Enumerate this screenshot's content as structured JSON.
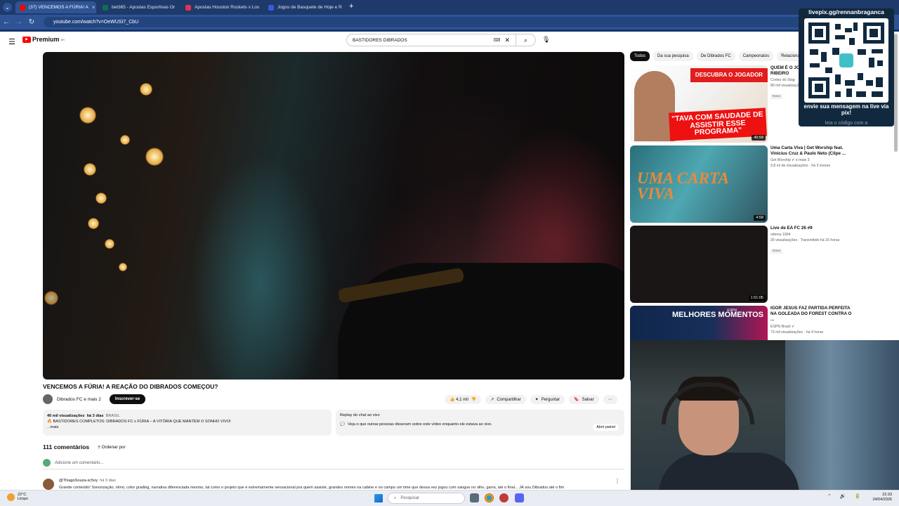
{
  "browser": {
    "tabs": [
      {
        "label": "(37) VENCEMOS A FÚRIA! A",
        "active": true,
        "color": "#ff0000"
      },
      {
        "label": "bet365 - Apostas Esportivas Or",
        "active": false,
        "color": "#126e51"
      },
      {
        "label": "Apostas Houston Rockets x Los",
        "active": false,
        "color": "#e0344a"
      },
      {
        "label": "Jogos de Basquete de Hoje e R",
        "active": false,
        "color": "#3a5bd9"
      }
    ],
    "url": "youtube.com/watch?v=OeWUSI7_CbU"
  },
  "youtube": {
    "logo": "Premium",
    "logo_badge": "BR",
    "search_value": "BASTIDORES DIBRADOS"
  },
  "video": {
    "title": "VENCEMOS A FÚRIA! A REAÇÃO DO DIBRADOS COMEÇOU?",
    "channel": "Dibrados FC e mais 2",
    "subscribe": "Inscrever-se",
    "likes": "4,1 mil",
    "share": "Compartilhar",
    "ask": "Perguntar",
    "save": "Salvar"
  },
  "description": {
    "views": "40 mil visualizações",
    "age": "há 3 dias",
    "country": "BRASIL",
    "text": "🔥 BASTIDORES COMPLETOS: DIBRADOS FC x FÚRIA – A VITÓRIA QUE MANTÉM O SONHO VIVO!",
    "more": "...mais"
  },
  "replay": {
    "title": "Replay do chat ao vivo",
    "text": "Veja o que outras pessoas disseram sobre este vídeo enquanto ele estava ao vivo.",
    "button": "Abrir painel"
  },
  "comments": {
    "count": "111 comentários",
    "sort": "Ordenar por",
    "add_placeholder": "Adicione um comentário...",
    "first": {
      "author": "@ThiagoSouza-sc5oy",
      "time": "há 3 dias",
      "text": "Grande conteúdo! Sonorização, ritmo, color grading, narrativa diferenciada mesmo, tal como o projeto que é extremamente sensacional pra quem assiste, grandes nomes na cabine e no campo um time que dessa vez jogou com sangue no olho, garra, até o final... JÁ sou Dibrados até o fim"
    }
  },
  "chips": [
    "Todos",
    "Da sua pesquisa",
    "De Dibrados FC",
    "Campeonatos",
    "Relacionados"
  ],
  "recommendations": [
    {
      "title": "QUEM É O JOGADOR? FT. CAIO RIBEIRO",
      "channel": "Cortes do Stag",
      "views": "80 mil visualizações",
      "badge": "Novo",
      "duration": "49:58",
      "thumb_banner": "DESCUBRA O JOGADOR",
      "thumb_caption": "\"TAVA COM SAUDADE DE ASSISTIR ESSE PROGRAMA\""
    },
    {
      "title": "Uma Carta Viva | Get Worship feat. Vinicius Cruz & Paulo Neto (Clipe ...",
      "channel": "Get Worship ✔ e mais 3",
      "views": "9,8 mi de visualizações · há 3 meses",
      "badge": "",
      "duration": "4:58",
      "thumb_caption": "UMA CARTA VIVA"
    },
    {
      "title": "Live de EA FC 26 #9",
      "channel": "vdemu 1904",
      "views": "26 visualizações · Transmitido há 16 horas",
      "badge": "Novo",
      "duration": "1:51:05"
    },
    {
      "title": "IGOR JESUS FAZ PARTIDA PERFEITA NA GOLEADA DO FOREST CONTRA O ...",
      "channel": "ESPN Brasil ✔",
      "views": "73 mil visualizações · há 4 horas",
      "badge": "Novo",
      "duration": "",
      "thumb_caption": "MELHORES MOMENTOS",
      "thumb_brand": "ESPN"
    }
  ],
  "overlay": {
    "handle": "livepix.gg/rennanbraganca",
    "caption": "envie sua mensagem na live via pix!",
    "caption2": "leia o código com a"
  },
  "taskbar": {
    "temp": "22°C",
    "weather": "Limpo",
    "search": "Pesquisar",
    "time": "22:33",
    "date": "24/04/2026"
  }
}
